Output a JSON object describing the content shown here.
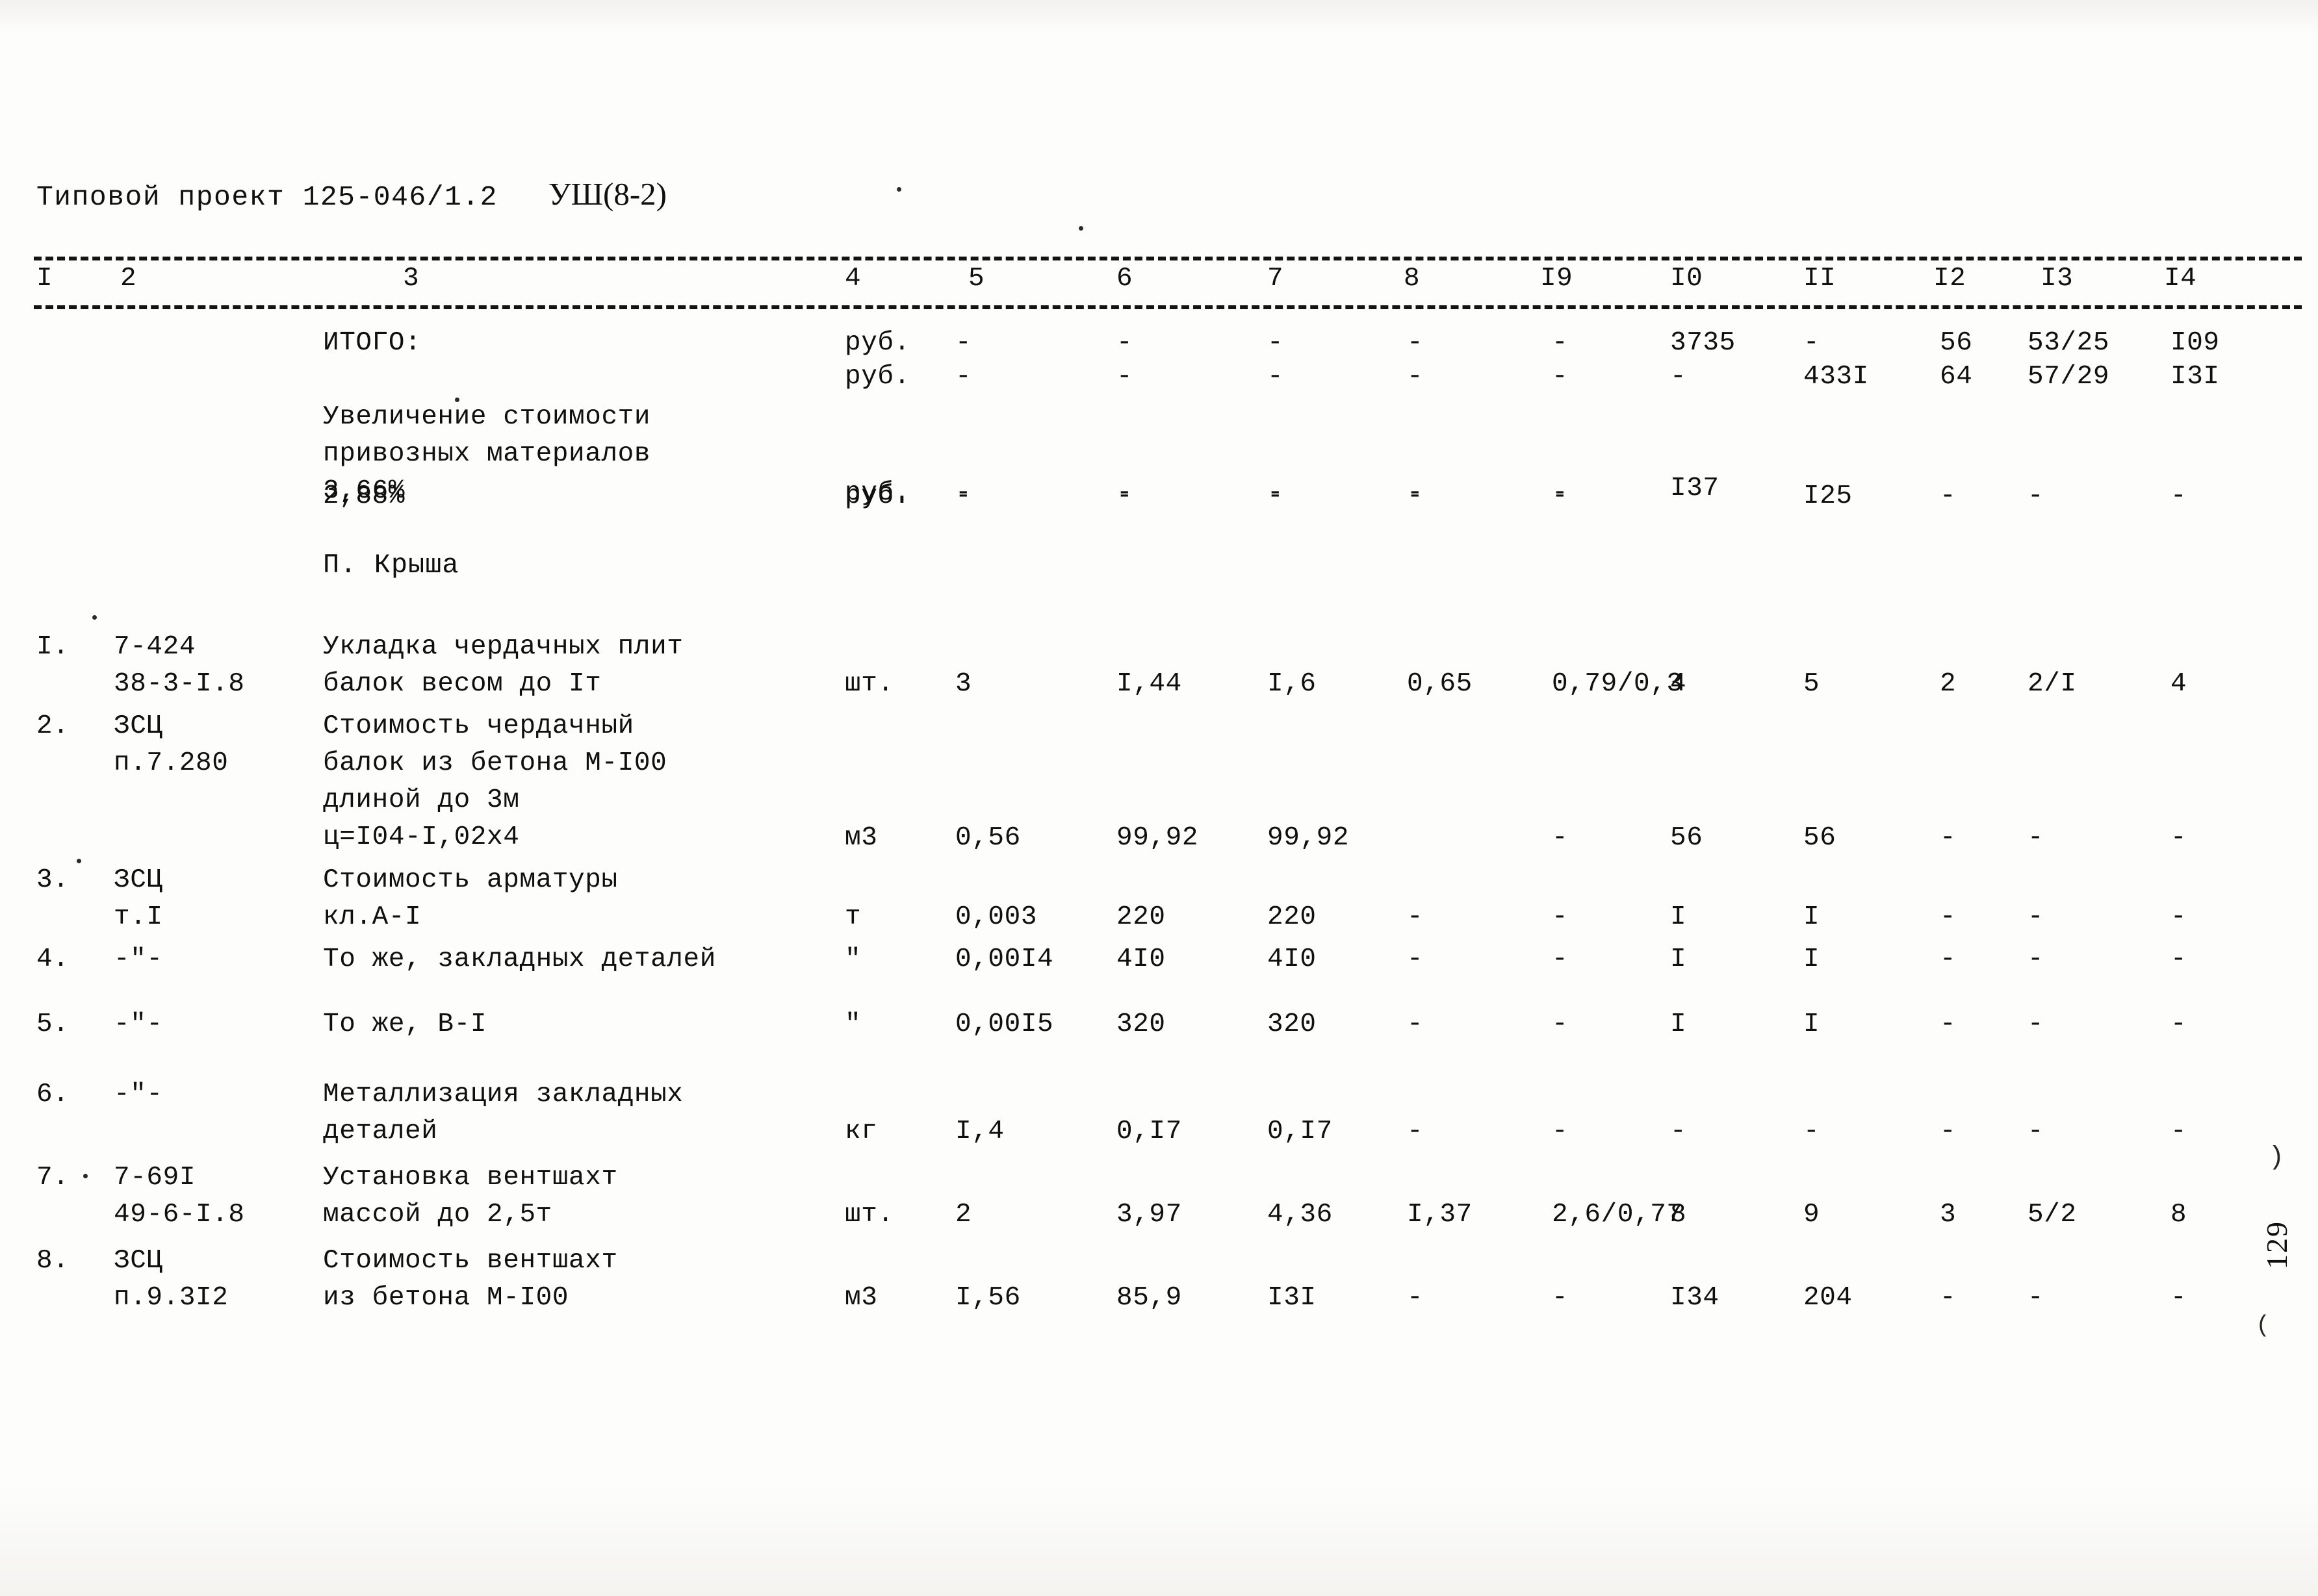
{
  "document": {
    "header_project_label": "Типовой проект 125-046/1.2",
    "sheet_code": "УШ(8-2)",
    "page_number": "129"
  },
  "table": {
    "column_numbers": [
      "I",
      "2",
      "3",
      "4",
      "5",
      "6",
      "7",
      "8",
      "I9",
      "I0",
      "II",
      "I2",
      "I3",
      "I4"
    ],
    "section_heading": "П. Крыша",
    "rows": [
      {
        "no": "",
        "code": "",
        "description": "ИТОГО:",
        "unit": "руб.",
        "c5": "-",
        "c6": "-",
        "c7": "-",
        "c8": "-",
        "c9": "-",
        "c10": "3735",
        "c11": "-",
        "c12": "56",
        "c13": "53/25",
        "c14": "I09"
      },
      {
        "no": "",
        "code": "",
        "description": "",
        "unit": "руб.",
        "c5": "-",
        "c6": "-",
        "c7": "-",
        "c8": "-",
        "c9": "-",
        "c10": "-",
        "c11": "433I",
        "c12": "64",
        "c13": "57/29",
        "c14": "I3I"
      },
      {
        "no": "",
        "code": "",
        "description": "Увеличение стоимости\nпривозных материалов\n3,66%",
        "unit": "руб.",
        "c5": "-",
        "c6": "-",
        "c7": "-",
        "c8": "-",
        "c9": "-",
        "c10": "I37",
        "c11": "",
        "c12": "",
        "c13": "",
        "c14": ""
      },
      {
        "no": "",
        "code": "",
        "description": "2,88%",
        "unit": "руб.",
        "c5": "-",
        "c6": "-",
        "c7": "-",
        "c8": "-",
        "c9": "-",
        "c10": "-",
        "c11": "I25",
        "c12": "-",
        "c13": "-",
        "c14": "-"
      },
      {
        "no": "I.",
        "code": "7-424\n38-3-I.8",
        "description": "Укладка чердачных плит\nбалок весом до Iт",
        "unit": "шт.",
        "c5": "3",
        "c6": "I,44",
        "c7": "I,6",
        "c8": "0,65",
        "c9": "0,79/0,3",
        "c10": "4",
        "c11": "5",
        "c12": "2",
        "c13": "2/I",
        "c14": "4"
      },
      {
        "no": "2.",
        "code": "ЗСЦ\nп.7.280",
        "description": "Стоимость чердачный\nбалок из бетона М-I00\nдлиной до 3м\nц=I04-I,02х4",
        "unit": "м3",
        "c5": "0,56",
        "c6": "99,92",
        "c7": "99,92",
        "c8": "",
        "c9": "-",
        "c10": "56",
        "c11": "56",
        "c12": "-",
        "c13": "-",
        "c14": "-"
      },
      {
        "no": "3.",
        "code": "ЗСЦ\nт.I",
        "description": "Стоимость арматуры\nкл.А-I",
        "unit": "т",
        "c5": "0,003",
        "c6": "220",
        "c7": "220",
        "c8": "-",
        "c9": "-",
        "c10": "I",
        "c11": "I",
        "c12": "-",
        "c13": "-",
        "c14": "-"
      },
      {
        "no": "4.",
        "code": "-\"-",
        "description": "То же, закладных деталей",
        "unit": "\"",
        "c5": "0,00I4",
        "c6": "4I0",
        "c7": "4I0",
        "c8": "-",
        "c9": "-",
        "c10": "I",
        "c11": "I",
        "c12": "-",
        "c13": "-",
        "c14": "-"
      },
      {
        "no": "5.",
        "code": "-\"-",
        "description": "То же, В-I",
        "unit": "\"",
        "c5": "0,00I5",
        "c6": "320",
        "c7": "320",
        "c8": "-",
        "c9": "-",
        "c10": "I",
        "c11": "I",
        "c12": "-",
        "c13": "-",
        "c14": "-"
      },
      {
        "no": "6.",
        "code": "-\"-",
        "description": "Металлизация закладных\nдеталей",
        "unit": "кг",
        "c5": "I,4",
        "c6": "0,I7",
        "c7": "0,I7",
        "c8": "-",
        "c9": "-",
        "c10": "-",
        "c11": "-",
        "c12": "-",
        "c13": "-",
        "c14": "-"
      },
      {
        "no": "7.",
        "code": "7-69I\n49-6-I.8",
        "description": "Установка вентшахт\nмассой до 2,5т",
        "unit": "шт.",
        "c5": "2",
        "c6": "3,97",
        "c7": "4,36",
        "c8": "I,37",
        "c9": "2,6/0,77",
        "c10": "8",
        "c11": "9",
        "c12": "3",
        "c13": "5/2",
        "c14": "8"
      },
      {
        "no": "8.",
        "code": "ЗСЦ\nп.9.3I2",
        "description": "Стоимость вентшахт\nиз бетона М-I00",
        "unit": "м3",
        "c5": "I,56",
        "c6": "85,9",
        "c7": "I3I",
        "c8": "-",
        "c9": "-",
        "c10": "I34",
        "c11": "204",
        "c12": "-",
        "c13": "-",
        "c14": "-"
      }
    ]
  }
}
